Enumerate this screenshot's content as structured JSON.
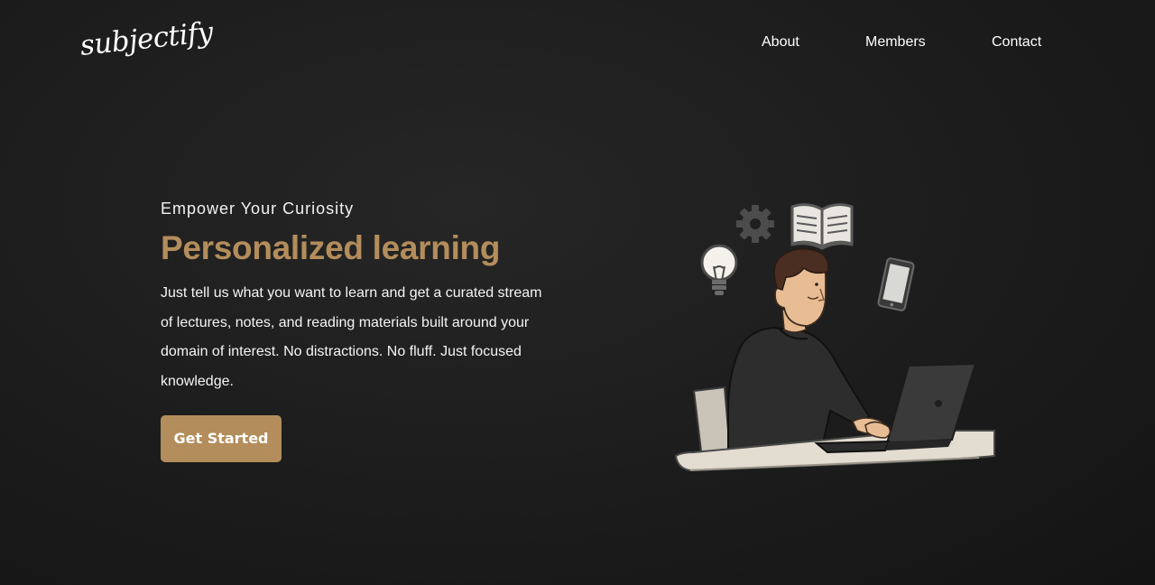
{
  "brand": {
    "logo_text": "subjectify"
  },
  "nav": {
    "items": [
      {
        "label": "About"
      },
      {
        "label": "Members"
      },
      {
        "label": "Contact"
      }
    ]
  },
  "hero": {
    "eyebrow": "Empower Your Curiosity",
    "headline": "Personalized learning",
    "description": "Just tell us what you want to learn and get a curated stream of lectures, notes, and reading materials built around your domain of interest. No distractions. No fluff. Just focused knowledge.",
    "cta_label": "Get Started"
  },
  "illustration": {
    "icons": [
      "lightbulb-icon",
      "gear-icon",
      "open-book-icon",
      "smartphone-icon"
    ],
    "scene": "person-typing-on-laptop"
  },
  "colors": {
    "background": "#1c1c1c",
    "accent": "#b38d5b",
    "text": "#ffffff"
  }
}
